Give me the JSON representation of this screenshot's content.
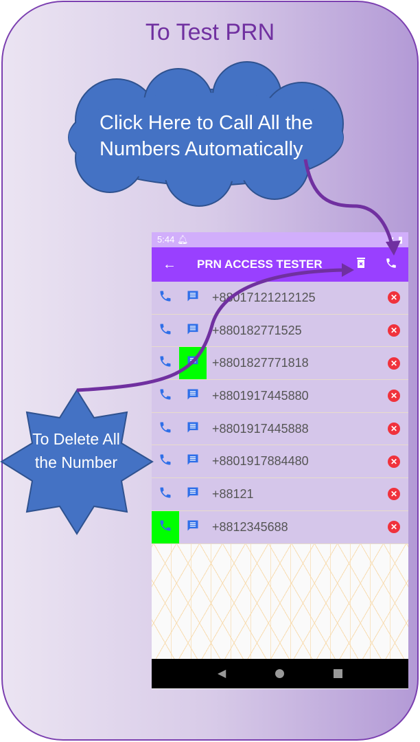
{
  "title": "To Test PRN",
  "callout_cloud": "Click Here to Call All the Numbers Automatically",
  "callout_star": "To Delete All the Number",
  "status_bar": {
    "time": "5:44"
  },
  "app_bar": {
    "title": "PRN ACCESS TESTER",
    "back_icon": "arrow-left",
    "delete_all_icon": "trash",
    "call_all_icon": "phone"
  },
  "numbers": [
    "+88017121212125",
    "+880182771525",
    "+8801827771818",
    "+8801917445880",
    "+8801917445888",
    "+8801917884480",
    "+88121",
    "+8812345688"
  ],
  "highlight_color": "#00ff00",
  "accent": "#9940ff"
}
